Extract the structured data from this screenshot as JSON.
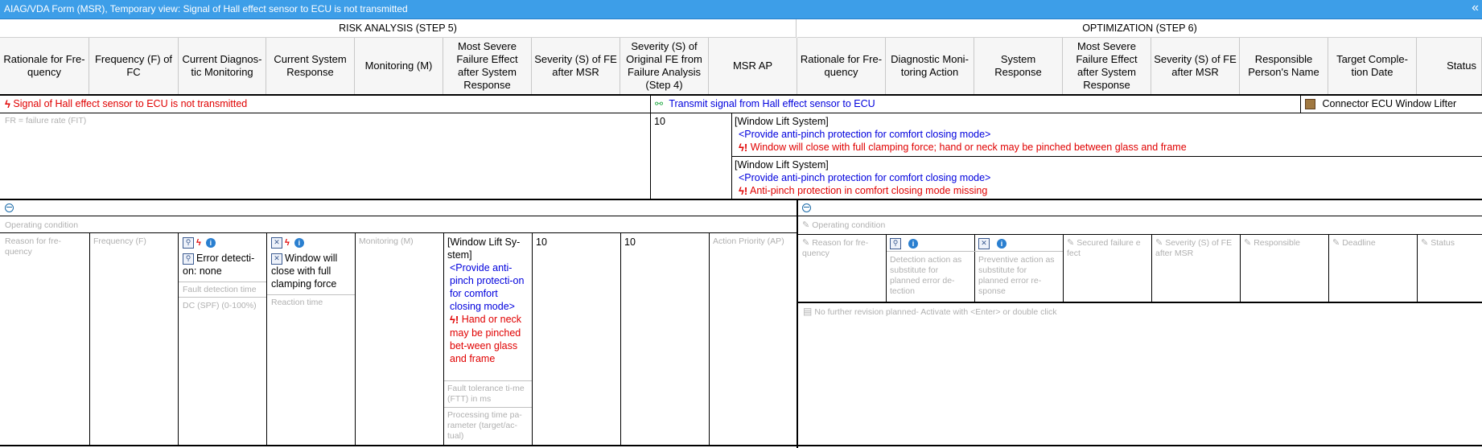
{
  "title_bar": {
    "text": "AIAG/VDA Form (MSR), Temporary view: Signal of Hall effect sensor to ECU is not transmitted",
    "collapse_glyph": "«"
  },
  "sections": {
    "risk": "RISK ANALYSIS (STEP 5)",
    "optimization": "OPTIMIZATION  (STEP 6)"
  },
  "columns": [
    "Rationale for Fre-quency",
    "Frequency (F) of FC",
    "Current Diagnos-tic Monitoring",
    "Current System Response",
    "Monitoring (M)",
    "Most Severe Failure Effect after System Response",
    "Severity (S) of FE after MSR",
    "Severity (S) of Original FE from Failure Analysis (Step 4)",
    "MSR AP",
    "Rationale for Fre-quency",
    "Diagnostic Moni-toring Action",
    "System Response",
    "Most Severe Failure Effect after System Response",
    "Severity (S) of FE after MSR",
    "Responsible Person's Name",
    "Target Comple-tion Date",
    "Status"
  ],
  "structure": {
    "failure_cause": "Signal of Hall effect sensor to ECU is not transmitted",
    "function": "Transmit signal from Hall effect sensor to ECU",
    "element": "Connector ECU Window Lifter",
    "fr_placeholder": "FR = failure rate (FIT)",
    "severity": "10",
    "effects": [
      {
        "system": "[Window Lift System]",
        "function": "<Provide anti-pinch protection for comfort closing mode>",
        "failure": "Window will close with full clamping force; hand or neck may be pinched between glass and frame"
      },
      {
        "system": "[Window Lift System]",
        "function": "<Provide anti-pinch protection for comfort closing mode>",
        "failure": "Anti-pinch protection in comfort closing mode missing"
      }
    ]
  },
  "risk": {
    "operating_condition": "Operating condition",
    "reason_placeholder": "Reason for fre-quency",
    "frequency_placeholder": "Frequency (F)",
    "diagnostic": {
      "text": "Error detecti-on: none",
      "fault_detection_time": "Fault detection time",
      "dc": "DC (SPF) (0-100%)"
    },
    "response": {
      "text": "Window will close with full clamping force",
      "reaction_time": "Reaction time"
    },
    "monitoring_placeholder": "Monitoring (M)",
    "effect": {
      "system": "[Window Lift Sy-stem]",
      "function": "<Provide anti-pinch protecti-on for comfort closing mode>",
      "failure": "Hand or neck may be pinched bet-ween glass and frame",
      "ftt": "Fault tolerance ti-me (FTT) in ms",
      "processing": "Processing time pa-rameter (target/ac-tual)"
    },
    "severity_msr": "10",
    "severity_orig": "10",
    "ap_placeholder": "Action Priority (AP)"
  },
  "optimization": {
    "operating_condition": "Operating condition",
    "reason_placeholder": "Reason for fre-quency",
    "detection_placeholder": "Detection action as substitute for planned error de-tection",
    "preventive_placeholder": "Preventive action as substitute for planned error re-sponse",
    "secured_placeholder": "Secured failure e fect",
    "severity_placeholder": "Severity (S) of FE after MSR",
    "responsible_placeholder": "Responsible",
    "deadline_placeholder": "Deadline",
    "status_placeholder": "Status",
    "revision_text": "No further revision planned- Activate with <Enter> or double click"
  },
  "colors": {
    "title_bar": "#3d9ee8",
    "failure_red": "#e00000",
    "function_blue": "#0000dd",
    "placeholder_gray": "#b0b0b0"
  }
}
